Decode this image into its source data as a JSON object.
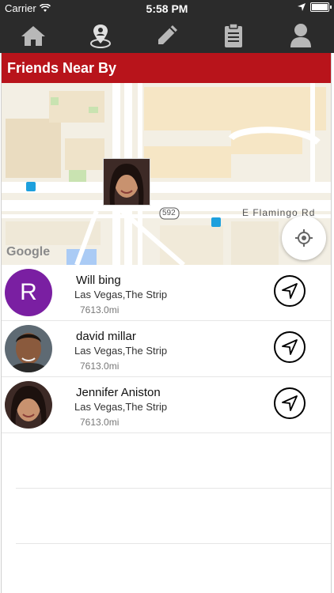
{
  "status": {
    "carrier": "Carrier",
    "time": "5:58 PM"
  },
  "nav": [
    {
      "icon": "home-icon"
    },
    {
      "icon": "map-pin-icon"
    },
    {
      "icon": "pencil-icon"
    },
    {
      "icon": "clipboard-icon"
    },
    {
      "icon": "profile-icon"
    }
  ],
  "header": {
    "title": "Friends Near By"
  },
  "map": {
    "road_label": "E Flamingo Rd",
    "route_badge": "592",
    "google": "Google"
  },
  "friends": [
    {
      "name": "Will bing",
      "location": "Las Vegas,The Strip",
      "distance": "7613.0mi",
      "avatar_letter": "R"
    },
    {
      "name": "david millar",
      "location": "Las Vegas,The Strip",
      "distance": "7613.0mi"
    },
    {
      "name": "Jennifer Aniston",
      "location": "Las Vegas,The Strip",
      "distance": "7613.0mi"
    }
  ],
  "colors": {
    "header": "#b8141b",
    "topbar": "#2b2b2b",
    "avatar_bg": "#7a1fa2"
  }
}
